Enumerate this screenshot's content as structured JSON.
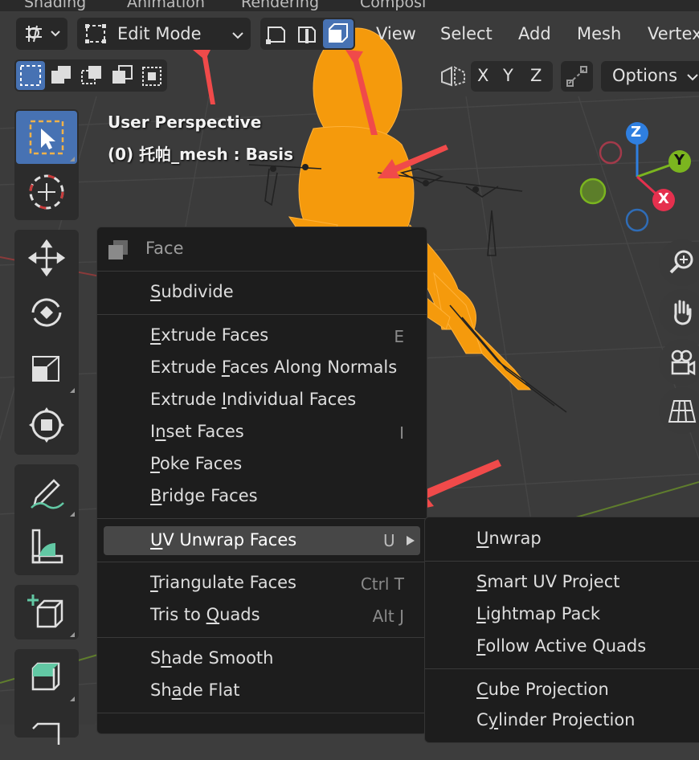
{
  "top_tabs": [
    "Shading",
    "Animation",
    "Rendering",
    "Composi"
  ],
  "header": {
    "mode_label": "Edit Mode",
    "menus": [
      "View",
      "Select",
      "Add",
      "Mesh",
      "Vertex"
    ],
    "options_label": "Options",
    "axes": [
      "X",
      "Y",
      "Z"
    ]
  },
  "viewport": {
    "perspective": "User Perspective",
    "object_info": "(0) 托帕_mesh : Basis"
  },
  "gizmo": {
    "z": "Z",
    "y": "Y",
    "x": "X"
  },
  "face_menu": {
    "title": "Face",
    "items": {
      "subdivide": {
        "pre": "",
        "key": "S",
        "post": "ubdivide"
      },
      "extrude_faces": {
        "pre": "",
        "key": "E",
        "post": "xtrude Faces",
        "shortcut": "E"
      },
      "extrude_along": {
        "pre": "Extrude ",
        "key": "F",
        "post": "aces Along Normals"
      },
      "extrude_individual": {
        "pre": "Extrude ",
        "key": "I",
        "post": "ndividual Faces"
      },
      "inset": {
        "pre": "I",
        "key": "n",
        "post": "set Faces",
        "shortcut": "I"
      },
      "poke": {
        "pre": "",
        "key": "P",
        "post": "oke Faces"
      },
      "bridge": {
        "pre": "",
        "key": "B",
        "post": "ridge Faces"
      },
      "uv_unwrap": {
        "pre": "",
        "key": "U",
        "post": "V Unwrap Faces",
        "shortcut": "U"
      },
      "triangulate": {
        "pre": "",
        "key": "T",
        "post": "riangulate Faces",
        "shortcut": "Ctrl T"
      },
      "tris_to_quads": {
        "pre": "Tris to ",
        "key": "Q",
        "post": "uads",
        "shortcut": "Alt J"
      },
      "shade_smooth": {
        "pre": "S",
        "key": "h",
        "post": "ade Smooth"
      },
      "shade_flat": {
        "pre": "Sh",
        "key": "a",
        "post": "de Flat"
      }
    }
  },
  "uv_submenu": {
    "unwrap": {
      "pre": "",
      "key": "U",
      "post": "nwrap"
    },
    "smart_uv": {
      "pre": "",
      "key": "S",
      "post": "mart UV Project"
    },
    "lightmap": {
      "pre": "",
      "key": "L",
      "post": "ightmap Pack"
    },
    "follow_quads": {
      "pre": "",
      "key": "F",
      "post": "ollow Active Quads"
    },
    "cube": {
      "pre": "",
      "key": "C",
      "post": "ube Projection"
    },
    "cylinder": {
      "pre": "C",
      "key": "y",
      "post": "linder Projection"
    }
  },
  "colors": {
    "accent_blue": "#4772b3",
    "mesh_orange": "#f59a0c",
    "arrow_red": "#f04a4a",
    "axis_x": "#e5304e",
    "axis_y": "#7bb51f",
    "axis_z": "#2f7fe0"
  }
}
